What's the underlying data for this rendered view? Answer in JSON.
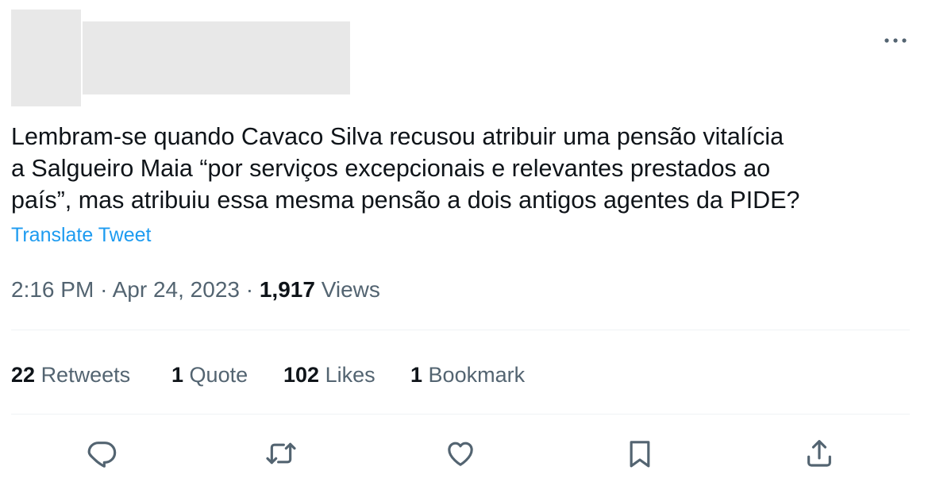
{
  "tweet": {
    "text": "Lembram-se quando Cavaco Silva recusou atribuir uma pensão vitalícia\na Salgueiro Maia “por serviços excepcionais e relevantes prestados ao\npaís”, mas atribuiu essa mesma pensão a dois antigos agentes da PIDE?",
    "translate_label": "Translate Tweet",
    "time": "2:16 PM",
    "date": "Apr 24, 2023",
    "separator": "·",
    "views_count": "1,917",
    "views_label": "Views"
  },
  "stats": {
    "retweets_count": "22",
    "retweets_label": "Retweets",
    "quotes_count": "1",
    "quotes_label": "Quote",
    "likes_count": "102",
    "likes_label": "Likes",
    "bookmarks_count": "1",
    "bookmarks_label": "Bookmark"
  },
  "icons": {
    "more": "more-horizontal-icon",
    "reply": "reply-icon",
    "retweet": "retweet-icon",
    "like": "heart-icon",
    "bookmark": "bookmark-icon",
    "share": "share-icon"
  },
  "colors": {
    "text": "#0f1419",
    "secondary": "#536471",
    "link": "#1d9bf0",
    "divider": "#eff3f4",
    "redacted": "#e8e8e8"
  }
}
